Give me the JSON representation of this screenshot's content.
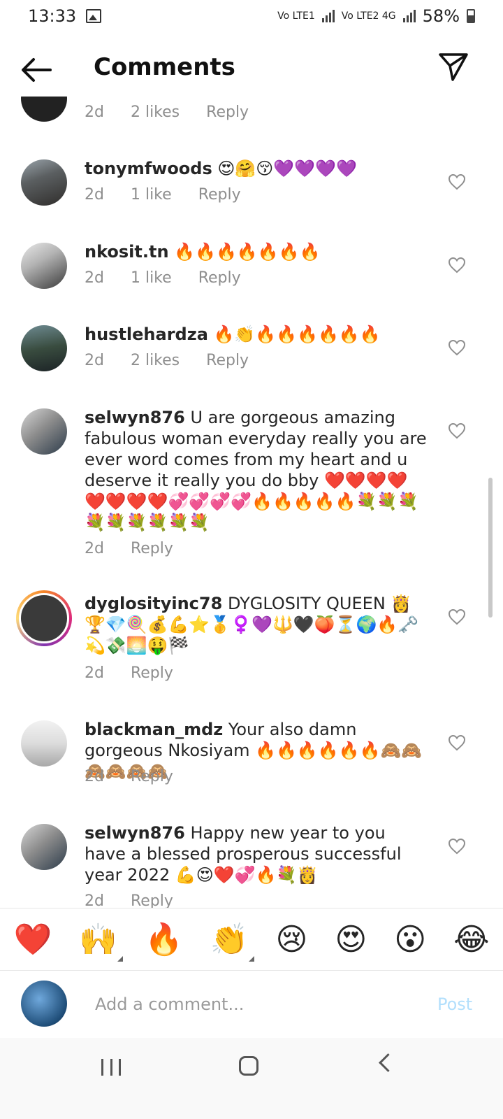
{
  "status_bar": {
    "time": "13:33",
    "network1": "Vo LTE1",
    "network2": "Vo LTE2 4G",
    "battery": "58%"
  },
  "header": {
    "title": "Comments",
    "back_icon": "arrow-left-icon",
    "send_icon": "paper-plane-icon"
  },
  "comments": [
    {
      "username": "",
      "text": "",
      "time": "2d",
      "likes": "2 likes",
      "reply": "Reply"
    },
    {
      "username": "tonymfwoods",
      "text": "😍🤗😚💜💜💜💜",
      "time": "2d",
      "likes": "1 like",
      "reply": "Reply"
    },
    {
      "username": "nkosit.tn",
      "text": "🔥🔥🔥🔥🔥🔥🔥",
      "time": "2d",
      "likes": "1 like",
      "reply": "Reply"
    },
    {
      "username": "hustlehardza",
      "text": "🔥👏🔥🔥🔥🔥🔥🔥",
      "time": "2d",
      "likes": "2 likes",
      "reply": "Reply"
    },
    {
      "username": "selwyn876",
      "text": "U are gorgeous amazing fabulous woman everyday really you are ever word comes from my heart and u deserve it really you do bby ❤️❤️❤️❤️❤️❤️❤️❤️💞💞💞💞🔥🔥🔥🔥🔥💐💐💐💐💐💐💐💐💐",
      "time": "2d",
      "likes": "",
      "reply": "Reply"
    },
    {
      "username": "dyglosityinc78",
      "text": "DYGLOSITY QUEEN 👸🏆💎🍭💰💪⭐🥇♀️💜🔱🖤🍑⏳🌍🔥🗝️💫💸🌅🤑🏁",
      "time": "2d",
      "likes": "",
      "reply": "Reply"
    },
    {
      "username": "blackman_mdz",
      "text": "Your also damn gorgeous Nkosiyam 🔥🔥🔥🔥🔥🔥🙈🙈🙈🙈🙈🙈",
      "time": "2d",
      "likes": "",
      "reply": "Reply"
    },
    {
      "username": "selwyn876",
      "text": "Happy new year to you have a blessed prosperous successful year 2022 💪😍❤️💞🔥💐👸",
      "time": "2d",
      "likes": "",
      "reply": "Reply"
    }
  ],
  "reactions": [
    "❤️",
    "🙌",
    "🔥",
    "👏",
    "😢",
    "😍",
    "😮",
    "😂"
  ],
  "input": {
    "placeholder": "Add a comment...",
    "post_label": "Post"
  },
  "colors": {
    "post_disabled": "#b2dffc",
    "secondary_text": "#8e8e8e",
    "primary_text": "#262626"
  }
}
